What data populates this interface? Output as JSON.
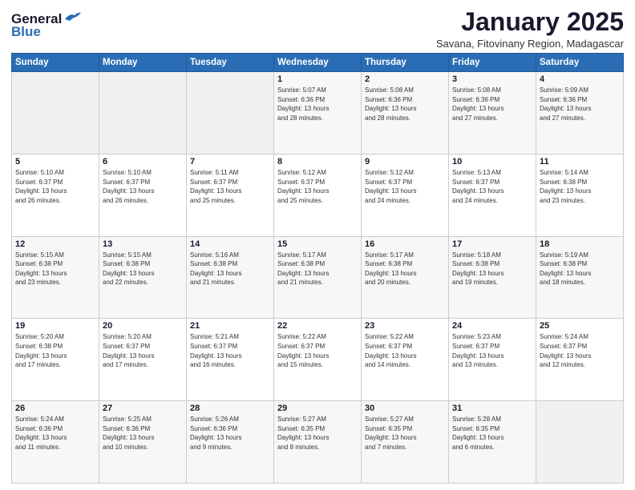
{
  "logo": {
    "general": "General",
    "blue": "Blue"
  },
  "title": "January 2025",
  "location": "Savana, Fitovinany Region, Madagascar",
  "days_of_week": [
    "Sunday",
    "Monday",
    "Tuesday",
    "Wednesday",
    "Thursday",
    "Friday",
    "Saturday"
  ],
  "weeks": [
    [
      {
        "day": "",
        "info": ""
      },
      {
        "day": "",
        "info": ""
      },
      {
        "day": "",
        "info": ""
      },
      {
        "day": "1",
        "info": "Sunrise: 5:07 AM\nSunset: 6:36 PM\nDaylight: 13 hours\nand 28 minutes."
      },
      {
        "day": "2",
        "info": "Sunrise: 5:08 AM\nSunset: 6:36 PM\nDaylight: 13 hours\nand 28 minutes."
      },
      {
        "day": "3",
        "info": "Sunrise: 5:08 AM\nSunset: 6:36 PM\nDaylight: 13 hours\nand 27 minutes."
      },
      {
        "day": "4",
        "info": "Sunrise: 5:09 AM\nSunset: 6:36 PM\nDaylight: 13 hours\nand 27 minutes."
      }
    ],
    [
      {
        "day": "5",
        "info": "Sunrise: 5:10 AM\nSunset: 6:37 PM\nDaylight: 13 hours\nand 26 minutes."
      },
      {
        "day": "6",
        "info": "Sunrise: 5:10 AM\nSunset: 6:37 PM\nDaylight: 13 hours\nand 26 minutes."
      },
      {
        "day": "7",
        "info": "Sunrise: 5:11 AM\nSunset: 6:37 PM\nDaylight: 13 hours\nand 25 minutes."
      },
      {
        "day": "8",
        "info": "Sunrise: 5:12 AM\nSunset: 6:37 PM\nDaylight: 13 hours\nand 25 minutes."
      },
      {
        "day": "9",
        "info": "Sunrise: 5:12 AM\nSunset: 6:37 PM\nDaylight: 13 hours\nand 24 minutes."
      },
      {
        "day": "10",
        "info": "Sunrise: 5:13 AM\nSunset: 6:37 PM\nDaylight: 13 hours\nand 24 minutes."
      },
      {
        "day": "11",
        "info": "Sunrise: 5:14 AM\nSunset: 6:38 PM\nDaylight: 13 hours\nand 23 minutes."
      }
    ],
    [
      {
        "day": "12",
        "info": "Sunrise: 5:15 AM\nSunset: 6:38 PM\nDaylight: 13 hours\nand 23 minutes."
      },
      {
        "day": "13",
        "info": "Sunrise: 5:15 AM\nSunset: 6:38 PM\nDaylight: 13 hours\nand 22 minutes."
      },
      {
        "day": "14",
        "info": "Sunrise: 5:16 AM\nSunset: 6:38 PM\nDaylight: 13 hours\nand 21 minutes."
      },
      {
        "day": "15",
        "info": "Sunrise: 5:17 AM\nSunset: 6:38 PM\nDaylight: 13 hours\nand 21 minutes."
      },
      {
        "day": "16",
        "info": "Sunrise: 5:17 AM\nSunset: 6:38 PM\nDaylight: 13 hours\nand 20 minutes."
      },
      {
        "day": "17",
        "info": "Sunrise: 5:18 AM\nSunset: 6:38 PM\nDaylight: 13 hours\nand 19 minutes."
      },
      {
        "day": "18",
        "info": "Sunrise: 5:19 AM\nSunset: 6:38 PM\nDaylight: 13 hours\nand 18 minutes."
      }
    ],
    [
      {
        "day": "19",
        "info": "Sunrise: 5:20 AM\nSunset: 6:38 PM\nDaylight: 13 hours\nand 17 minutes."
      },
      {
        "day": "20",
        "info": "Sunrise: 5:20 AM\nSunset: 6:37 PM\nDaylight: 13 hours\nand 17 minutes."
      },
      {
        "day": "21",
        "info": "Sunrise: 5:21 AM\nSunset: 6:37 PM\nDaylight: 13 hours\nand 16 minutes."
      },
      {
        "day": "22",
        "info": "Sunrise: 5:22 AM\nSunset: 6:37 PM\nDaylight: 13 hours\nand 15 minutes."
      },
      {
        "day": "23",
        "info": "Sunrise: 5:22 AM\nSunset: 6:37 PM\nDaylight: 13 hours\nand 14 minutes."
      },
      {
        "day": "24",
        "info": "Sunrise: 5:23 AM\nSunset: 6:37 PM\nDaylight: 13 hours\nand 13 minutes."
      },
      {
        "day": "25",
        "info": "Sunrise: 5:24 AM\nSunset: 6:37 PM\nDaylight: 13 hours\nand 12 minutes."
      }
    ],
    [
      {
        "day": "26",
        "info": "Sunrise: 5:24 AM\nSunset: 6:36 PM\nDaylight: 13 hours\nand 11 minutes."
      },
      {
        "day": "27",
        "info": "Sunrise: 5:25 AM\nSunset: 6:36 PM\nDaylight: 13 hours\nand 10 minutes."
      },
      {
        "day": "28",
        "info": "Sunrise: 5:26 AM\nSunset: 6:36 PM\nDaylight: 13 hours\nand 9 minutes."
      },
      {
        "day": "29",
        "info": "Sunrise: 5:27 AM\nSunset: 6:35 PM\nDaylight: 13 hours\nand 8 minutes."
      },
      {
        "day": "30",
        "info": "Sunrise: 5:27 AM\nSunset: 6:35 PM\nDaylight: 13 hours\nand 7 minutes."
      },
      {
        "day": "31",
        "info": "Sunrise: 5:28 AM\nSunset: 6:35 PM\nDaylight: 13 hours\nand 6 minutes."
      },
      {
        "day": "",
        "info": ""
      }
    ]
  ]
}
